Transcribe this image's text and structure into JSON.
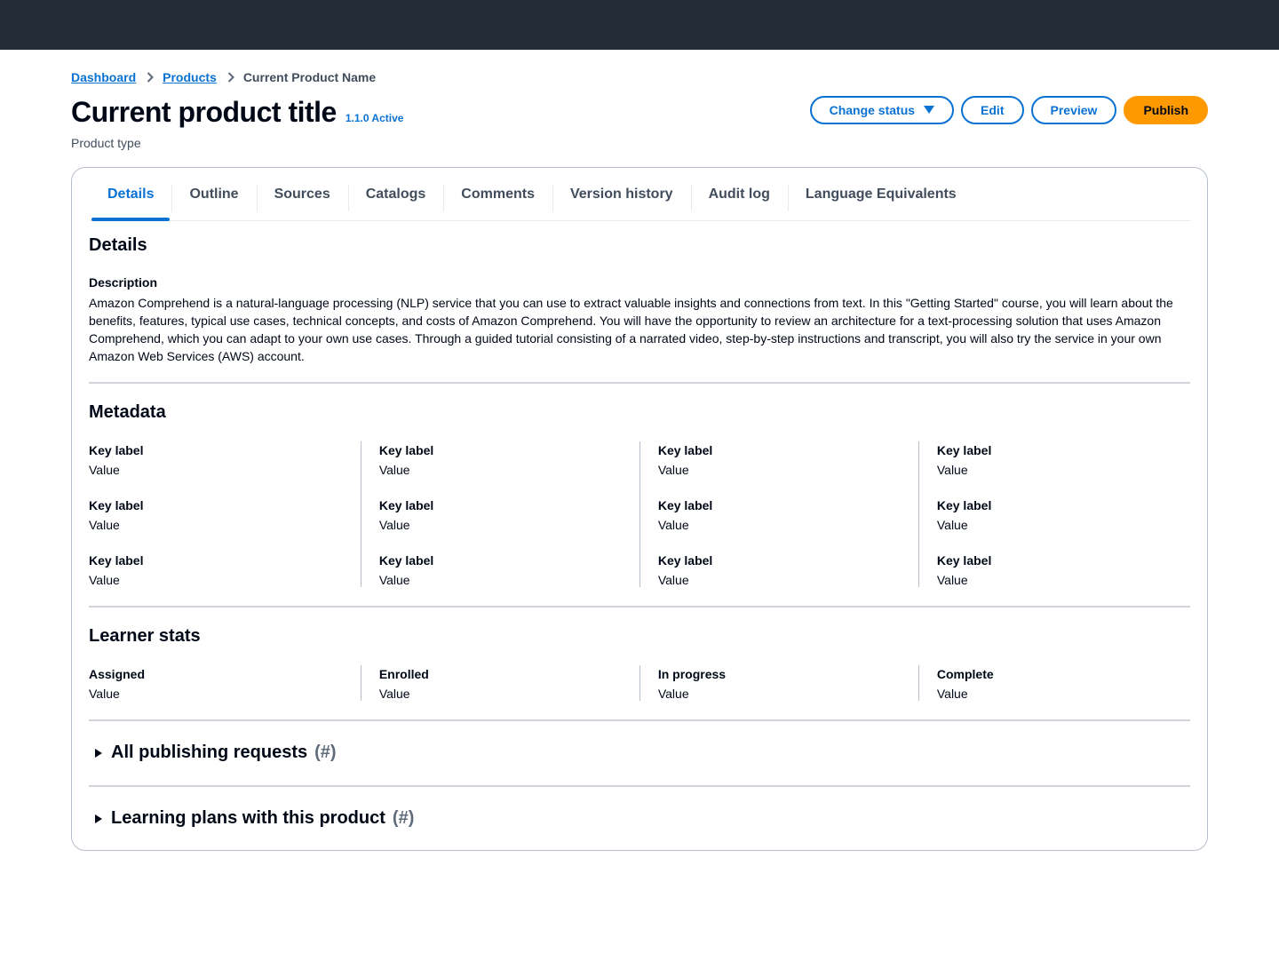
{
  "breadcrumb": {
    "items": [
      "Dashboard",
      "Products"
    ],
    "current": "Current Product Name"
  },
  "header": {
    "title": "Current product title",
    "version_badge": "1.1.0 Active",
    "subtitle": "Product type"
  },
  "actions": {
    "change_status": "Change status",
    "edit": "Edit",
    "preview": "Preview",
    "publish": "Publish"
  },
  "tabs": [
    "Details",
    "Outline",
    "Sources",
    "Catalogs",
    "Comments",
    "Version history",
    "Audit log",
    "Language Equivalents"
  ],
  "details": {
    "heading": "Details",
    "description_label": "Description",
    "description": "Amazon Comprehend is a natural-language processing (NLP) service that you can use to extract valuable insights and connections from text. In this \"Getting Started\" course, you will learn about the benefits, features, typical use cases, technical concepts, and costs of Amazon Comprehend. You will have the opportunity to review an architecture for a text-processing solution that uses Amazon Comprehend, which you can adapt to your own use cases. Through a guided tutorial consisting of a narrated video, step-by-step instructions and transcript, you will also try the service in your own Amazon Web Services (AWS) account."
  },
  "metadata": {
    "heading": "Metadata",
    "columns": [
      [
        {
          "key": "Key label",
          "value": "Value"
        },
        {
          "key": "Key label",
          "value": "Value"
        },
        {
          "key": "Key label",
          "value": "Value"
        }
      ],
      [
        {
          "key": "Key label",
          "value": "Value"
        },
        {
          "key": "Key label",
          "value": "Value"
        },
        {
          "key": "Key label",
          "value": "Value"
        }
      ],
      [
        {
          "key": "Key label",
          "value": "Value"
        },
        {
          "key": "Key label",
          "value": "Value"
        },
        {
          "key": "Key label",
          "value": "Value"
        }
      ],
      [
        {
          "key": "Key label",
          "value": "Value"
        },
        {
          "key": "Key label",
          "value": "Value"
        },
        {
          "key": "Key label",
          "value": "Value"
        }
      ]
    ]
  },
  "learner_stats": {
    "heading": "Learner stats",
    "items": [
      {
        "key": "Assigned",
        "value": "Value"
      },
      {
        "key": "Enrolled",
        "value": "Value"
      },
      {
        "key": "In progress",
        "value": "Value"
      },
      {
        "key": "Complete",
        "value": "Value"
      }
    ]
  },
  "expanders": [
    {
      "label": "All publishing requests",
      "count": "(#)"
    },
    {
      "label": "Learning plans with this product",
      "count": "(#)"
    }
  ],
  "colors": {
    "topbar": "#232b37",
    "link": "#0972d3",
    "primary_button": "#ff9900",
    "text": "#000716"
  }
}
